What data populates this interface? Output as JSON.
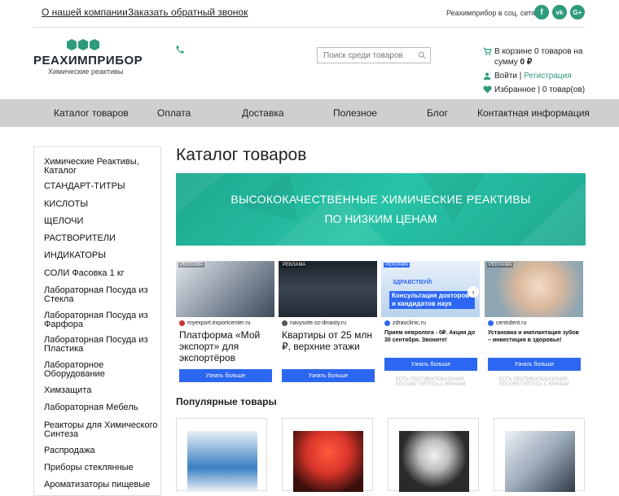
{
  "topbar": {
    "links": [
      "О нашей компании",
      "Заказать обратный звонок"
    ],
    "social_label": "Реахимприбор в соц. сетях:",
    "social": [
      {
        "glyph": "f",
        "icon": "facebook-icon"
      },
      {
        "glyph": "vk",
        "icon": "vk-icon"
      },
      {
        "glyph": "G+",
        "icon": "google-plus-icon"
      }
    ]
  },
  "logo": {
    "name": "РЕАХИМПРИБОР",
    "subtitle": "Химические реактивы"
  },
  "search": {
    "placeholder": "Поиск среди товаров"
  },
  "cart": {
    "line1": "В корзине 0 товаров на",
    "line2_prefix": "сумму ",
    "line2_amount": "0 ₽",
    "login": "Войти",
    "sep": "|",
    "register": "Регистрация",
    "favorites": "Избранное",
    "favorites_count": "0 товар(ов)"
  },
  "nav": [
    "Каталог товаров",
    "Оплата",
    "Доставка",
    "Полезное",
    "Блог",
    "Контактная информация"
  ],
  "sidebar": [
    "Химические Реактивы, Каталог",
    "СТАНДАРТ-ТИТРЫ",
    "КИСЛОТЫ",
    "ЩЕЛОЧИ",
    "РАСТВОРИТЕЛИ",
    "ИНДИКАТОРЫ",
    "СОЛИ Фасовка 1 кг",
    "Лабораторная Посуда из Стекла",
    "Лабораторная Посуда из Фарфора",
    "Лабораторная Посуда из Пластика",
    "Лабораторное Оборудование",
    "Химзащита",
    "Лабораторная Мебель",
    "Реакторы для Химического Синтеза",
    "Распродажа",
    "Приборы стеклянные",
    "Ароматизаторы пищевые"
  ],
  "page_title": "Каталог товаров",
  "banner": {
    "line1": "ВЫСОКОКАЧЕСТВЕННЫЕ ХИМИЧЕСКИЕ РЕАКТИВЫ",
    "line2": "ПО НИЗКИМ ЦЕНАМ"
  },
  "ads": [
    {
      "tag": "РЕКЛАМА",
      "domain": "myexport.exportcenter.ru",
      "headline": "Платформа «Мой экспорт» для экспортёров",
      "button": "Узнать больше",
      "footer": "",
      "color": "#5e6a78"
    },
    {
      "tag": "РЕКЛАМА",
      "domain": "navysote.sz-dinasty.ru",
      "headline": "Квартиры от 25 млн ₽, верхние этажи",
      "button": "Узнать больше",
      "footer": "",
      "color": "#2b3440"
    },
    {
      "tag": "РЕКЛАМА",
      "domain": "zdravclinic.ru",
      "headline": "Прием невролога - 0₽. Акция до 30 сентября. Звоните!",
      "button": "Узнать больше",
      "footer": "ЕСТЬ ПРОТИВОПОКАЗАНИЯ. ПОСОВЕТУЙТЕСЬ С ВРАЧОМ",
      "color": "#a9c8ea"
    },
    {
      "tag": "РЕКЛАМА",
      "domain": "centrdent.ru",
      "headline": "Установка и имплантация зубов – инвестиция в здоровье!",
      "button": "Узнать больше",
      "footer": "ЕСТЬ ПРОТИВОПОКАЗАНИЯ. ПОСОВЕТУЙТЕСЬ С ВРАЧОМ",
      "color": "#d9b89c"
    }
  ],
  "ad_overlay_zdrav": {
    "brand": "ЗДРАВСТВУЙ!",
    "text": "Консультация докторов и кандидатов наук"
  },
  "popular_title": "Популярные товары",
  "products": [
    {
      "icon": "ampoules-image",
      "color": "#3a7fc4"
    },
    {
      "icon": "flask-flame-image",
      "color": "#d8342a"
    },
    {
      "icon": "dry-ice-image",
      "color": "#2a2a2a"
    },
    {
      "icon": "microscope-image",
      "color": "#9aa8b8"
    }
  ],
  "colors": {
    "accent": "#2e9b7c",
    "nav_bg": "#cfcfcf",
    "banner": "#22b59a",
    "ad_button": "#2c67f2"
  }
}
